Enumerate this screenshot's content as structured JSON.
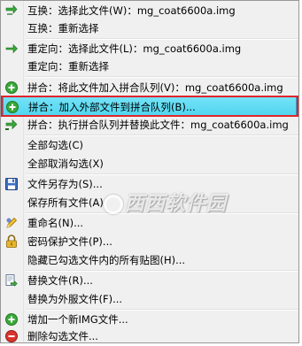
{
  "menu": {
    "items": [
      {
        "label": "互换：选择此文件(W)：mg_coat6600a.img",
        "icon": "swap-arrow-icon"
      },
      {
        "label": "互换：重新选择",
        "icon": ""
      },
      {
        "label": "重定向：选择此文件(L)：mg_coat6600a.img",
        "icon": "redirect-arrow-icon"
      },
      {
        "label": "重定向：重新选择",
        "icon": ""
      },
      {
        "label": "拼合：将此文件加入拼合队列(V)：mg_coat6600a.img",
        "icon": "green-plus-icon"
      },
      {
        "label": "拼合：加入外部文件到拼合队列(B)...",
        "icon": "green-plus-icon"
      },
      {
        "label": "拼合：执行拼合队列并替换此文件：mg_coat6600a.img",
        "icon": "merge-arrow-icon"
      },
      {
        "label": "全部勾选(C)",
        "icon": ""
      },
      {
        "label": "全部取消勾选(X)",
        "icon": ""
      },
      {
        "label": "文件另存为(S)...",
        "icon": "floppy-disk-icon"
      },
      {
        "label": "保存所有文件(A)",
        "icon": ""
      },
      {
        "label": "重命名(N)...",
        "icon": "rename-pencil-icon"
      },
      {
        "label": "密码保护文件(P)...",
        "icon": "padlock-icon"
      },
      {
        "label": "隐藏已勾选文件内的所有贴图(H)...",
        "icon": ""
      },
      {
        "label": "替换文件(R)...",
        "icon": "replace-file-icon"
      },
      {
        "label": "替换为外服文件(F)...",
        "icon": ""
      },
      {
        "label": "增加一个新IMG文件...",
        "icon": "green-plus-icon"
      },
      {
        "label": "删除勾选文件...",
        "icon": "red-minus-icon"
      }
    ],
    "highlighted_index": 5
  },
  "watermark": {
    "text": "西西软件园"
  },
  "colors": {
    "menu_bg": "#f0f0f0",
    "highlight": "#5bdcf3",
    "annotation_box": "#e0242c",
    "green": "#3aa83a",
    "red": "#d9352d"
  }
}
